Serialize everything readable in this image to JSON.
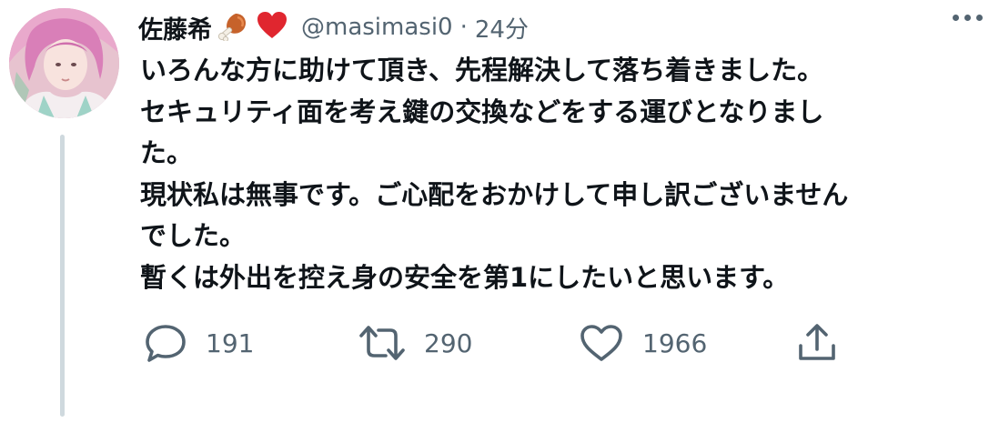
{
  "tweet": {
    "display_name": "佐藤希",
    "badges": [
      "meat-on-bone-emoji",
      "red-heart-emoji"
    ],
    "handle": "@masimasi0",
    "separator": "·",
    "timestamp": "24分",
    "lines": [
      "いろんな方に助けて頂き、先程解決して落ち着きました。",
      "セキュリティ面を考え鍵の交換などをする運びとなりまし",
      "た。",
      "現状私は無事です。ご心配をおかけして申し訳ございません",
      "でした。",
      "暫くは外出を控え身の安全を第1にしたいと思います。"
    ]
  },
  "actions": {
    "reply": {
      "icon": "reply-icon",
      "count": "191"
    },
    "retweet": {
      "icon": "retweet-icon",
      "count": "290"
    },
    "like": {
      "icon": "heart-icon",
      "count": "1966"
    },
    "share": {
      "icon": "share-icon"
    }
  },
  "colors": {
    "text": "#0f1419",
    "secondary": "#536471",
    "thread_line": "#cfd9de",
    "heart_emoji": "#e0262f"
  }
}
